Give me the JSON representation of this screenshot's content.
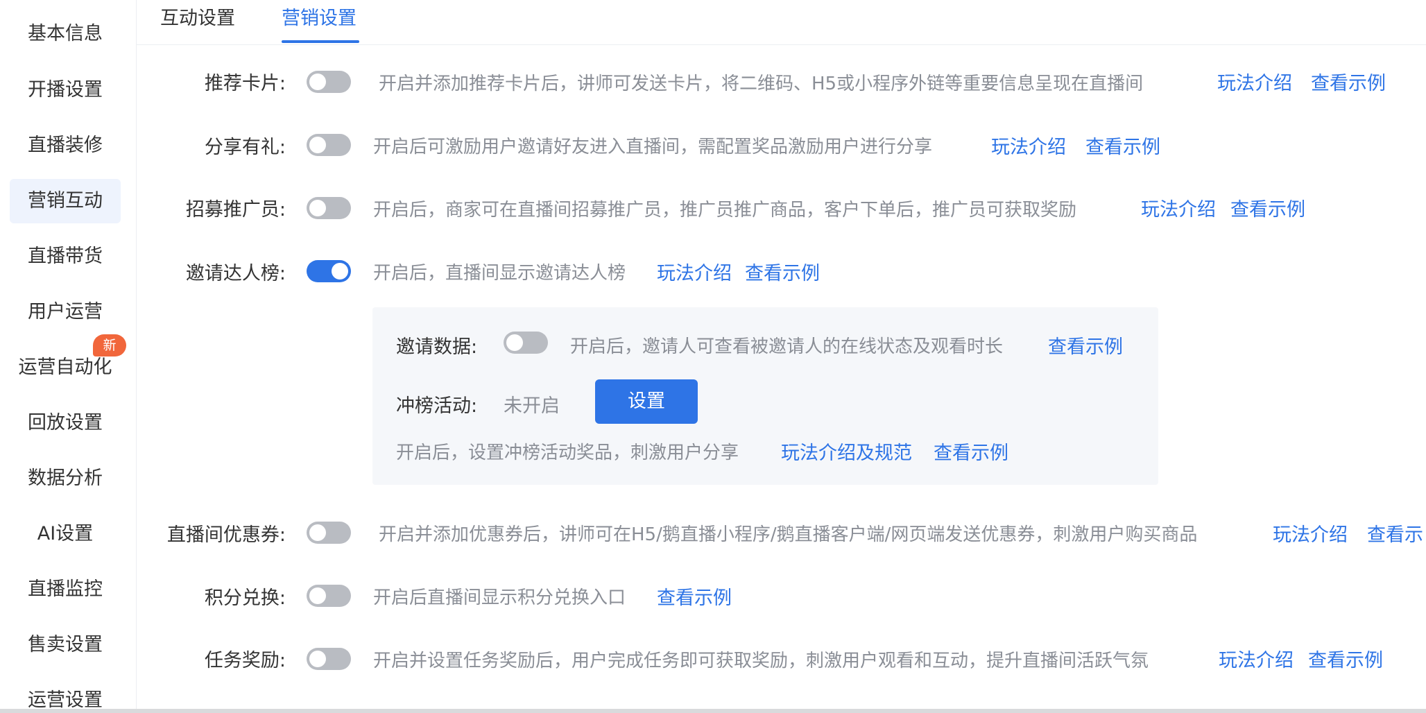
{
  "sidebar": {
    "items": [
      {
        "label": "基本信息"
      },
      {
        "label": "开播设置"
      },
      {
        "label": "直播装修"
      },
      {
        "label": "营销互动"
      },
      {
        "label": "直播带货"
      },
      {
        "label": "用户运营"
      },
      {
        "label": "运营自动化"
      },
      {
        "label": "回放设置"
      },
      {
        "label": "数据分析"
      },
      {
        "label": "AI设置"
      },
      {
        "label": "直播监控"
      },
      {
        "label": "售卖设置"
      },
      {
        "label": "运营设置"
      }
    ],
    "active_index": 3,
    "new_badge": "新"
  },
  "tabs": [
    {
      "label": "互动设置"
    },
    {
      "label": "营销设置"
    }
  ],
  "active_tab": 1,
  "settings": {
    "recommend_card": {
      "label": "推荐卡片:",
      "enabled": false,
      "desc": "开启并添加推荐卡片后，讲师可发送卡片，将二维码、H5或小程序外链等重要信息呈现在直播间",
      "link_intro": "玩法介绍",
      "link_example": "查看示例"
    },
    "share_gift": {
      "label": "分享有礼:",
      "enabled": false,
      "desc": "开启后可激励用户邀请好友进入直播间，需配置奖品激励用户进行分享",
      "link_intro": "玩法介绍",
      "link_example": "查看示例"
    },
    "recruit_promoter": {
      "label": "招募推广员:",
      "enabled": false,
      "desc": "开启后，商家可在直播间招募推广员，推广员推广商品，客户下单后，推广员可获取奖励",
      "link_intro": "玩法介绍",
      "link_example": "查看示例"
    },
    "invite_rank": {
      "label": "邀请达人榜:",
      "enabled": true,
      "desc": "开启后，直播间显示邀请达人榜",
      "link_intro": "玩法介绍",
      "link_example": "查看示例",
      "invite_data": {
        "label": "邀请数据:",
        "enabled": false,
        "desc": "开启后，邀请人可查看被邀请人的在线状态及观看时长",
        "link_example": "查看示例"
      },
      "rank_activity": {
        "label": "冲榜活动:",
        "status": "未开启",
        "button": "设置",
        "desc": "开启后，设置冲榜活动奖品，刺激用户分享",
        "link_intro": "玩法介绍及规范",
        "link_example": "查看示例"
      }
    },
    "coupon": {
      "label": "直播间优惠券:",
      "enabled": false,
      "desc": "开启并添加优惠券后，讲师可在H5/鹅直播小程序/鹅直播客户端/网页端发送优惠券，刺激用户购买商品",
      "link_intro": "玩法介绍",
      "link_example": "查看示"
    },
    "points_exchange": {
      "label": "积分兑换:",
      "enabled": false,
      "desc": "开启后直播间显示积分兑换入口",
      "link_example": "查看示例"
    },
    "task_reward": {
      "label": "任务奖励:",
      "enabled": false,
      "desc": "开启并设置任务奖励后，用户完成任务即可获取奖励，刺激用户观看和互动，提升直播间活跃气氛",
      "link_intro": "玩法介绍",
      "link_example": "查看示例"
    }
  },
  "colors": {
    "accent": "#2e74e6",
    "toggle_off": "#b9bcc2",
    "badge": "#f1663b",
    "active_bg": "#eef3fd",
    "panel_bg": "#f5f7fa"
  }
}
